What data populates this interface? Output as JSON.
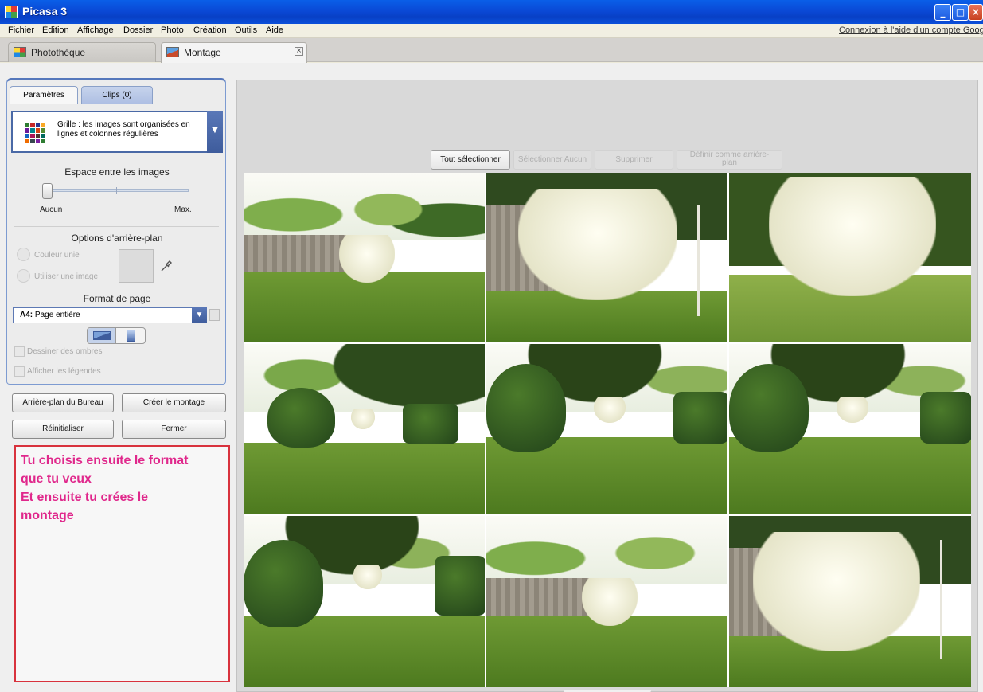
{
  "window": {
    "title": "Picasa 3"
  },
  "menu": {
    "items": [
      "Fichier",
      "Édition",
      "Affichage",
      "Dossier",
      "Photo",
      "Création",
      "Outils",
      "Aide"
    ],
    "help_link": "Connexion à l'aide d'un compte Google"
  },
  "tabs": [
    {
      "label": "Photothèque"
    },
    {
      "label": "Montage"
    }
  ],
  "panel": {
    "tab_params": "Paramètres",
    "tab_clips": "Clips (0)",
    "layout_text": "Grille : les images sont organisées en lignes et colonnes régulières",
    "spacing_title": "Espace entre les images",
    "slider_min": "Aucun",
    "slider_max": "Max.",
    "bg_title": "Options d'arrière-plan",
    "radio_color": "Couleur unie",
    "radio_image": "Utiliser une image",
    "format_title": "Format de page",
    "format_size": "A4:",
    "format_value": "Page entière",
    "check_shadows": "Dessiner des ombres",
    "check_captions": "Afficher les légendes"
  },
  "buttons": {
    "desktop_bg": "Arrière-plan du Bureau",
    "create": "Créer le montage",
    "reset": "Réinitialiser",
    "close": "Fermer"
  },
  "note": {
    "lines": [
      "Tu choisis ensuite le format",
      "que tu veux",
      "Et ensuite tu crées le",
      "montage"
    ]
  },
  "selection": {
    "select_all": "Tout sélectionner",
    "select_none": "Sélectionner Aucun",
    "delete": "Supprimer",
    "set_bg_line1": "Définir comme arrière-",
    "set_bg_line2": "plan"
  },
  "colors": {
    "note_text": "#e0288c",
    "note_border": "#d8323d",
    "title_bar": "#0a49d6"
  }
}
